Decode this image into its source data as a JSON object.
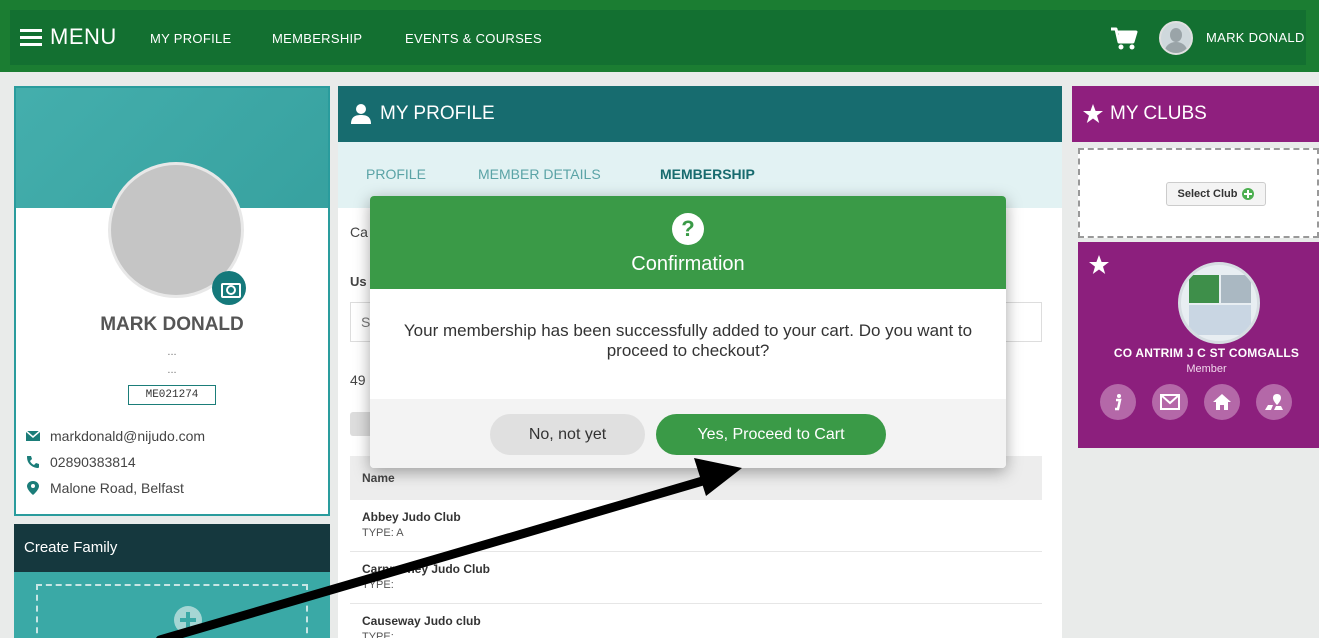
{
  "topnav": {
    "menu_label": "MENU",
    "links": [
      "MY PROFILE",
      "MEMBERSHIP",
      "EVENTS & COURSES"
    ],
    "user_name": "MARK DONALD"
  },
  "profile": {
    "name": "MARK DONALD",
    "line1": "...",
    "line2": "...",
    "member_id": "ME021274",
    "email": "markdonald@nijudo.com",
    "phone": "02890383814",
    "address": "Malone Road, Belfast"
  },
  "family": {
    "title": "Create Family"
  },
  "main": {
    "title": "MY PROFILE",
    "tabs": [
      "PROFILE",
      "MEMBER DETAILS",
      "MEMBERSHIP"
    ],
    "active_tab": "MEMBERSHIP",
    "peek_ca": "Ca",
    "peek_us": "Us",
    "peek_s": "S",
    "peek_49": "49",
    "table_header": "Name",
    "rows": [
      {
        "name": "Abbey Judo Club",
        "type": "TYPE: A"
      },
      {
        "name": "Carnmoney Judo Club",
        "type": "TYPE:"
      },
      {
        "name": "Causeway Judo club",
        "type": "TYPE:"
      }
    ]
  },
  "clubs": {
    "title": "MY CLUBS",
    "select_label": "Select Club",
    "club_name": "CO ANTRIM J C ST COMGALLS",
    "club_role": "Member"
  },
  "modal": {
    "title": "Confirmation",
    "message": "Your membership has been successfully added to your cart. Do you want to proceed to checkout?",
    "no_label": "No, not yet",
    "yes_label": "Yes, Proceed to Cart"
  }
}
